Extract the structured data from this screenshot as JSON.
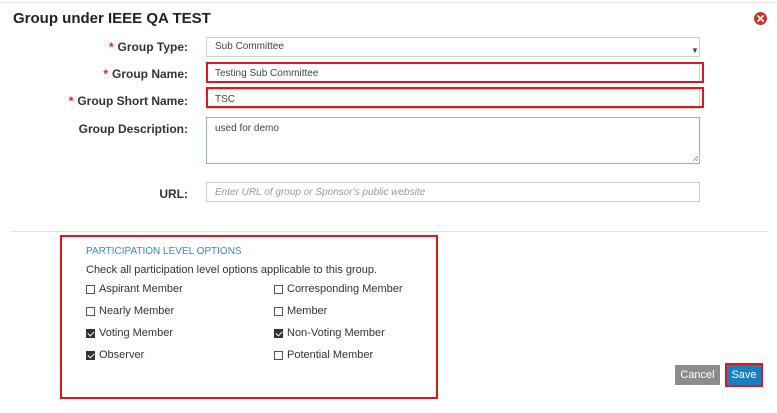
{
  "dialog": {
    "title": "Group under IEEE QA TEST"
  },
  "form": {
    "group_type": {
      "label": "Group Type:",
      "value": "Sub Committee",
      "required_mark": "*"
    },
    "group_name": {
      "label": "Group Name:",
      "value": "Testing Sub Committee",
      "required_mark": "*"
    },
    "group_short_name": {
      "label": "Group Short Name:",
      "value": "TSC",
      "required_mark": "*"
    },
    "group_description": {
      "label": "Group Description:",
      "value": "used for demo"
    },
    "url": {
      "label": "URL:",
      "value": "",
      "placeholder": "Enter URL of group or Sponsor's public website"
    }
  },
  "participation": {
    "title": "PARTICIPATION LEVEL OPTIONS",
    "description": "Check all participation level options applicable to this group.",
    "options": [
      {
        "label": "Aspirant Member",
        "checked": false
      },
      {
        "label": "Corresponding Member",
        "checked": false
      },
      {
        "label": "Nearly Member",
        "checked": false
      },
      {
        "label": "Member",
        "checked": false
      },
      {
        "label": "Voting Member",
        "checked": true
      },
      {
        "label": "Non-Voting Member",
        "checked": true
      },
      {
        "label": "Observer",
        "checked": true
      },
      {
        "label": "Potential Member",
        "checked": false
      }
    ]
  },
  "footer": {
    "cancel_label": "Cancel",
    "save_label": "Save"
  },
  "colors": {
    "highlight": "#e2151b",
    "primary": "#1a7fc1",
    "secondary": "#8c8c8c",
    "close": "#c0392b",
    "section_title": "#3a87b8"
  }
}
